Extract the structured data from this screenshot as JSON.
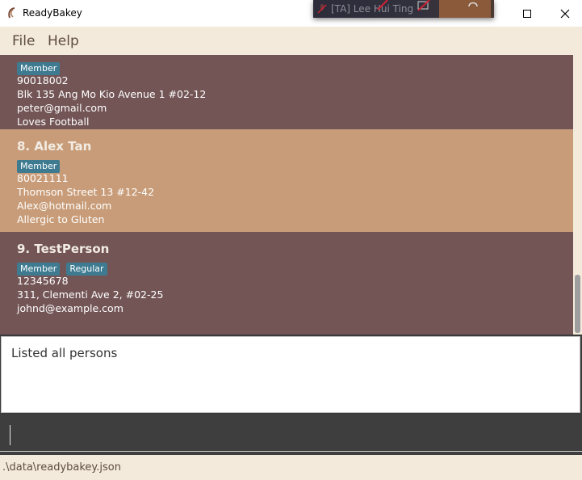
{
  "window": {
    "title": "ReadyBakey"
  },
  "overlay": {
    "caller_text": "[TA] Lee Hui Ting"
  },
  "menu": {
    "file": "File",
    "help": "Help"
  },
  "persons": [
    {
      "name": "",
      "tags": [
        "Member"
      ],
      "phone": "90018002",
      "address": "Blk 135 Ang Mo Kio Avenue 1 #02-12",
      "email": "peter@gmail.com",
      "remark": "Loves Football"
    },
    {
      "name": "8.  Alex Tan",
      "tags": [
        "Member"
      ],
      "phone": "80021111",
      "address": "Thomson Street 13 #12-42",
      "email": "Alex@hotmail.com",
      "remark": "Allergic to Gluten"
    },
    {
      "name": "9.  TestPerson",
      "tags": [
        "Member",
        "Regular"
      ],
      "phone": "12345678",
      "address": "311, Clementi Ave 2, #02-25",
      "email": "johnd@example.com",
      "remark": ""
    }
  ],
  "result": {
    "text": "Listed all persons"
  },
  "command": {
    "value": ""
  },
  "status": {
    "path": ".\\data\\readybakey.json"
  },
  "colors": {
    "card_dark": "#735556",
    "card_light": "#c89c78",
    "tag": "#3e7b91",
    "menu_bg": "#f3eadb"
  }
}
